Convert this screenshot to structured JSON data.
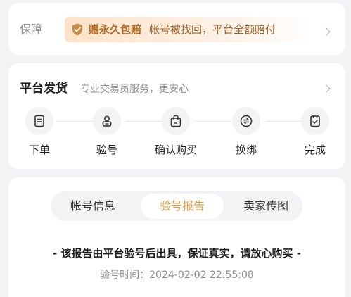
{
  "guarantee": {
    "label": "保障",
    "badge_strong": "赠永久包赔",
    "badge_desc": "帐号被找回，平台全额赔付",
    "icon": "shield-check-icon",
    "accent_color": "#b46a22"
  },
  "delivery": {
    "title": "平台发货",
    "subtitle": "专业交易员服务，更安心",
    "steps": [
      {
        "label": "下单",
        "icon": "order-document-icon"
      },
      {
        "label": "验号",
        "icon": "account-inspect-icon"
      },
      {
        "label": "确认购买",
        "icon": "shopping-bag-icon"
      },
      {
        "label": "换绑",
        "icon": "rebind-exchange-icon"
      },
      {
        "label": "完成",
        "icon": "complete-check-icon"
      }
    ]
  },
  "report": {
    "tabs": [
      {
        "label": "帐号信息",
        "active": false
      },
      {
        "label": "验号报告",
        "active": true
      },
      {
        "label": "卖家传图",
        "active": false
      }
    ],
    "statement": "- 该报告由平台验号后出具，保证真实，请放心购买 -",
    "inspect_time": "验号时间：2024-02-02 22:55:08",
    "active_color": "#e69a44"
  }
}
